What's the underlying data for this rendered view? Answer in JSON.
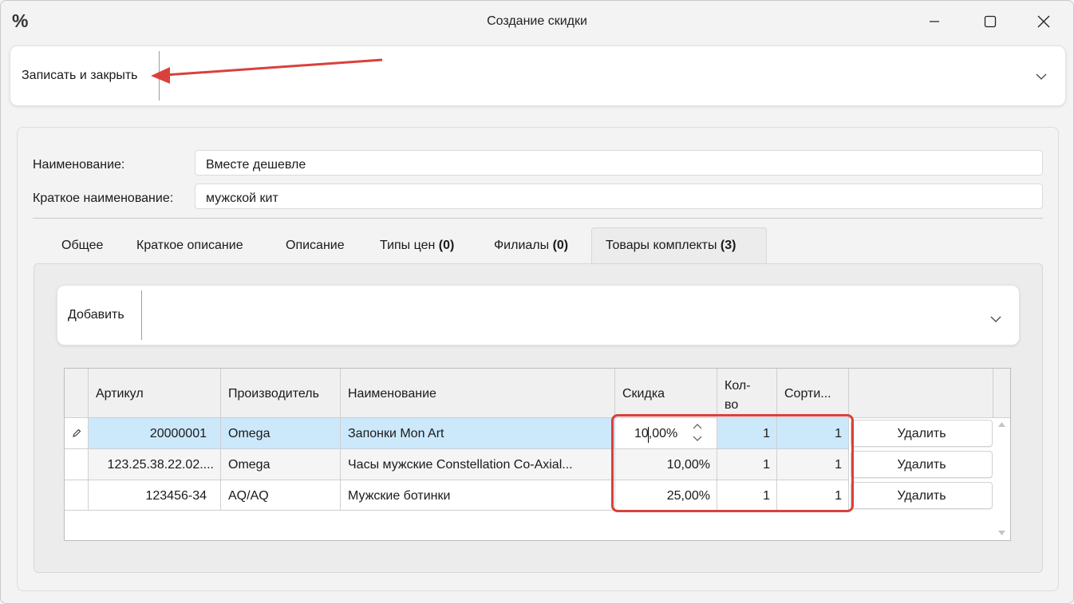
{
  "window": {
    "title": "Создание скидки",
    "app_icon": "%"
  },
  "toolbar": {
    "save_close_label": "Записать и закрыть"
  },
  "form": {
    "name_label": "Наименование:",
    "name_value": "Вместе дешевле",
    "short_name_label": "Краткое наименование:",
    "short_name_value": "мужской кит"
  },
  "tabs": [
    {
      "label": "Общее",
      "count": ""
    },
    {
      "label": "Краткое описание",
      "count": ""
    },
    {
      "label": "Описание",
      "count": ""
    },
    {
      "label": "Типы цен",
      "count": "(0)"
    },
    {
      "label": "Филиалы",
      "count": "(0)"
    },
    {
      "label": "Товары комплекты",
      "count": "(3)"
    }
  ],
  "active_tab": "Товары комплекты",
  "kit_toolbar": {
    "add_label": "Добавить"
  },
  "grid": {
    "columns": [
      "Артикул",
      "Производитель",
      "Наименование",
      "Скидка",
      "Кол-во",
      "Сорти..."
    ],
    "rows": [
      {
        "article": "20000001",
        "manufacturer": "Omega",
        "name": "Запонки Mon Art",
        "discount": "10,00%",
        "qty": "1",
        "sort": "1",
        "action": "Удалить"
      },
      {
        "article": "123.25.38.22.02....",
        "manufacturer": "Omega",
        "name": "Часы мужские Constellation  Co-Axial...",
        "discount": "10,00%",
        "qty": "1",
        "sort": "1",
        "action": "Удалить"
      },
      {
        "article": "123456-34",
        "manufacturer": "AQ/AQ",
        "name": "Мужские ботинки",
        "discount": "25,00%",
        "qty": "1",
        "sort": "1",
        "action": "Удалить"
      }
    ]
  },
  "colors": {
    "selection": "#cce8fb",
    "annotation": "#d9413b"
  },
  "icons": [
    "minimize-icon",
    "maximize-icon",
    "close-icon",
    "chevron-down-icon",
    "pencil-icon",
    "spin-up-icon",
    "spin-down-icon",
    "scroll-up-icon",
    "scroll-down-icon"
  ]
}
